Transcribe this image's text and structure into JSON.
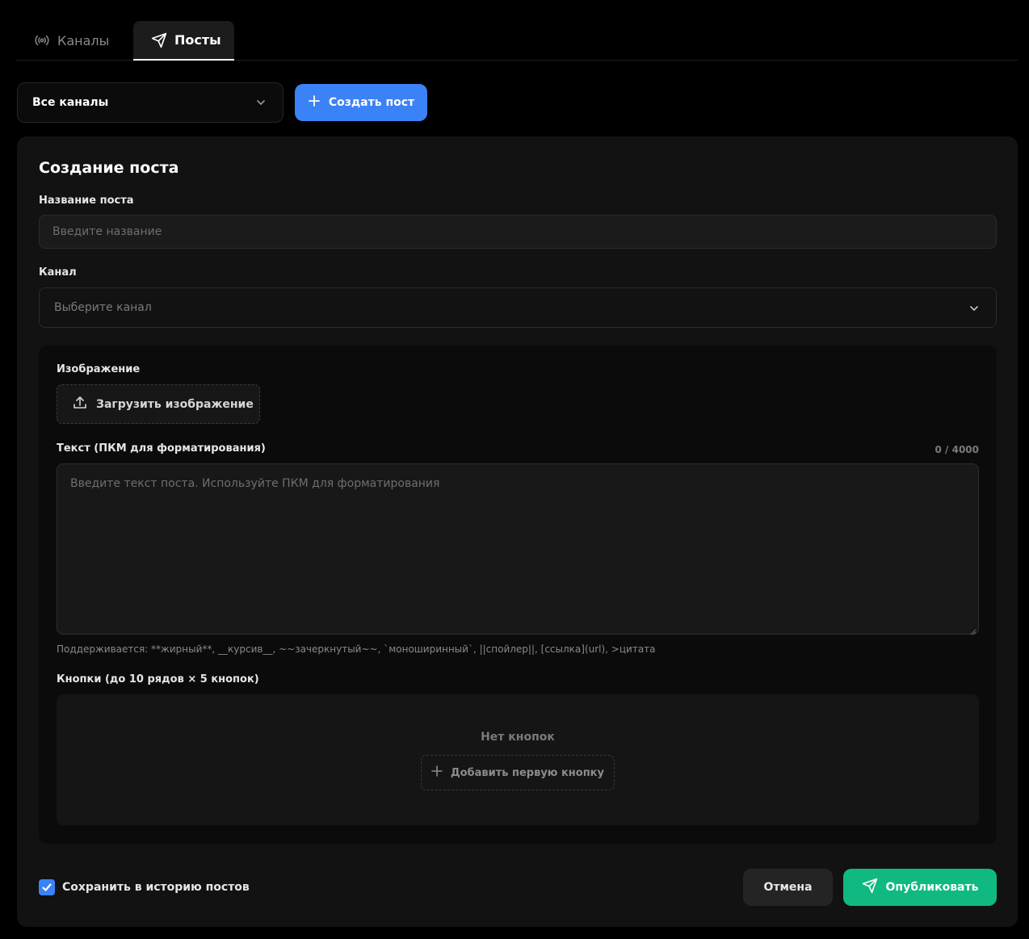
{
  "tabs": [
    {
      "label": "Каналы",
      "icon": "broadcast-icon",
      "active": false
    },
    {
      "label": "Посты",
      "icon": "send-icon",
      "active": true
    }
  ],
  "toolbar": {
    "channel_filter": "Все каналы",
    "create_post_label": "Создать пост"
  },
  "form": {
    "title": "Создание поста",
    "post_name_label": "Название поста",
    "post_name_placeholder": "Введите название",
    "channel_label": "Канал",
    "channel_placeholder": "Выберите канал",
    "image_label": "Изображение",
    "upload_label": "Загрузить изображение",
    "text_label": "Текст (ПКМ для форматирования)",
    "text_counter": "0 / 4000",
    "text_placeholder": "Введите текст поста. Используйте ПКМ для форматирования",
    "format_hint": "Поддерживается: **жирный**, __курсив__, ~~зачеркнутый~~, `моноширинный`, ||спойлер||, [ссылка](url), >цитата",
    "buttons_label": "Кнопки (до 10 рядов × 5 кнопок)",
    "no_buttons_text": "Нет кнопок",
    "add_first_button_label": "Добавить первую кнопку",
    "save_history_label": "Сохранить в историю постов",
    "save_history_checked": true,
    "cancel_label": "Отмена",
    "publish_label": "Опубликовать"
  },
  "colors": {
    "accent_blue": "#3b82f6",
    "publish_green": "#10b981",
    "background": "#000000",
    "card": "#121212"
  }
}
